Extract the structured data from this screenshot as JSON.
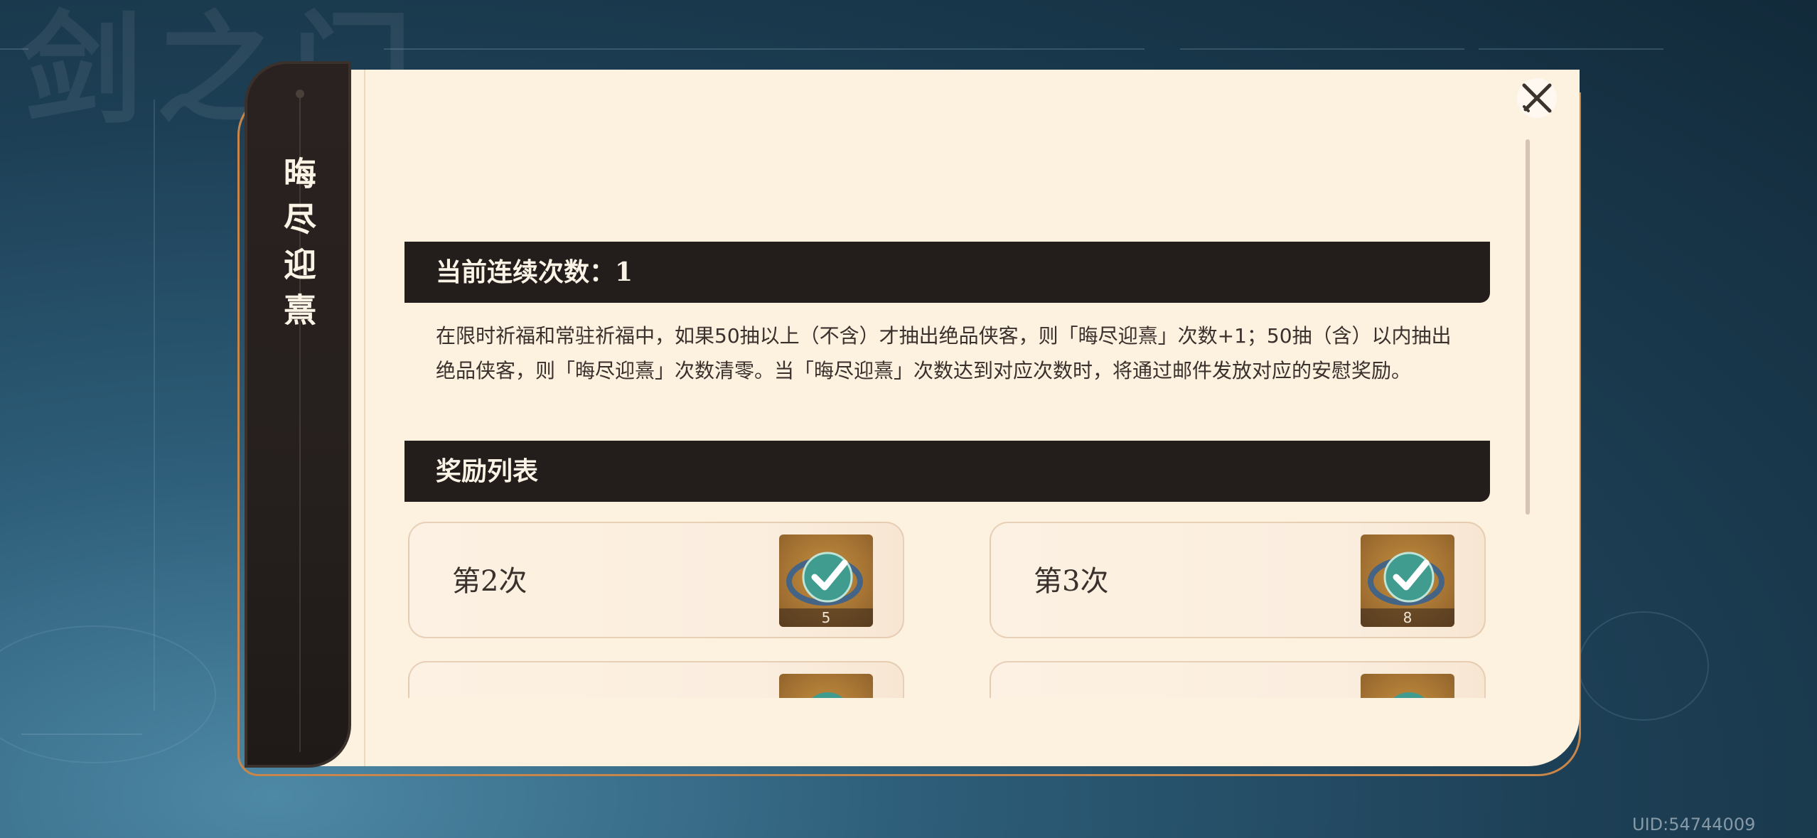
{
  "sidebar": {
    "title": "晦尽迎熹"
  },
  "close_button": {
    "icon": "close-icon"
  },
  "streak": {
    "label": "当前连续次数：1"
  },
  "description": "在限时祈福和常驻祈福中，如果50抽以上（不含）才抽出绝品侠客，则「晦尽迎熹」次数+1；50抽（含）以内抽出绝品侠客，则「晦尽迎熹」次数清零。当「晦尽迎熹」次数达到对应次数时，将通过邮件发放对应的安慰奖励。",
  "reward_section": {
    "title": "奖励列表"
  },
  "rewards": [
    {
      "label": "第2次",
      "item_icon": "coin-check-icon",
      "count": "5"
    },
    {
      "label": "第3次",
      "item_icon": "coin-check-icon",
      "count": "8"
    },
    {
      "label": "",
      "item_icon": "coin-check-icon",
      "count": ""
    },
    {
      "label": "",
      "item_icon": "coin-check-icon",
      "count": ""
    }
  ],
  "uid": "UID:54744009",
  "colors": {
    "panel": "#fdf1e0",
    "header_bar": "#231d1b",
    "accent_outline": "#c8864a"
  }
}
